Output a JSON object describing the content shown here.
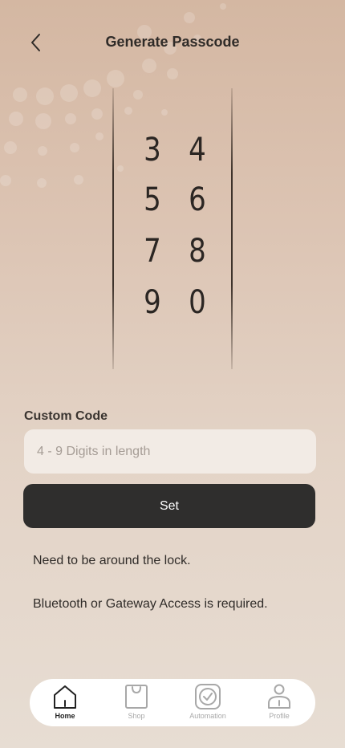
{
  "header": {
    "title": "Generate Passcode",
    "back_icon": "chevron-left-icon"
  },
  "keypad": {
    "keys": [
      {
        "label": "3"
      },
      {
        "label": "4"
      },
      {
        "label": "5"
      },
      {
        "label": "6"
      },
      {
        "label": "7"
      },
      {
        "label": "8"
      },
      {
        "label": "9"
      },
      {
        "label": "0"
      }
    ]
  },
  "custom_code": {
    "label": "Custom Code",
    "value": "",
    "placeholder": "4 - 9 Digits in length"
  },
  "set_button": {
    "label": "Set"
  },
  "notes": [
    "Need to be around the lock.",
    "Bluetooth or Gateway Access is required."
  ],
  "tabbar": {
    "items": [
      {
        "label": "Home",
        "icon": "home-icon",
        "active": true
      },
      {
        "label": "Shop",
        "icon": "shopping-bag-icon",
        "active": false
      },
      {
        "label": "Automation",
        "icon": "automation-icon",
        "active": false
      },
      {
        "label": "Profile",
        "icon": "profile-icon",
        "active": false
      }
    ]
  },
  "colors": {
    "background_top": "#d4b7a2",
    "background_bottom": "#e7ddd3",
    "button_dark": "#2f2e2d",
    "input_bg": "#f2ebe5"
  }
}
